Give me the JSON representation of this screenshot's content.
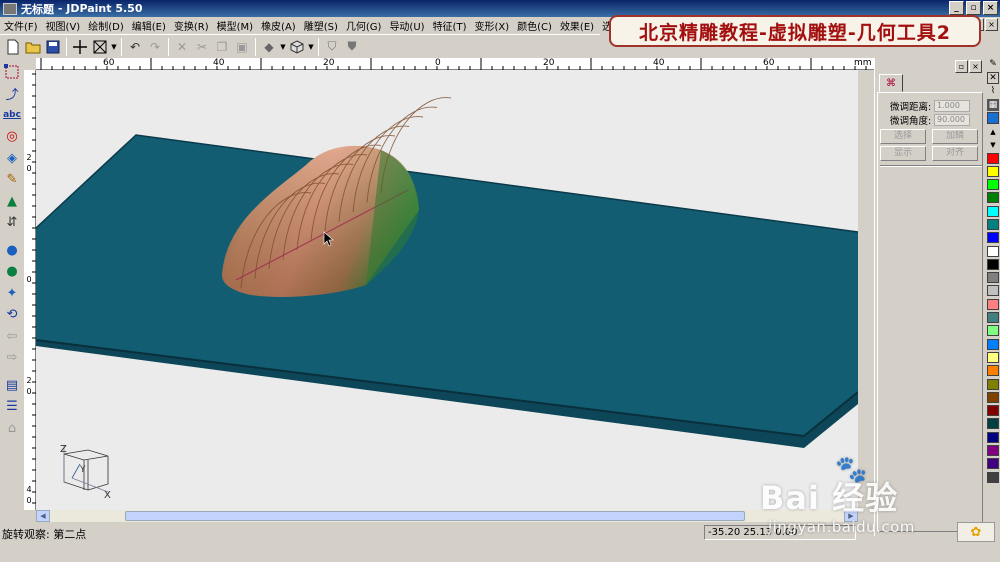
{
  "window": {
    "doc_title": "无标题",
    "app_title": "JDPaint 5.50"
  },
  "menu": [
    "文件(F)",
    "视图(V)",
    "绘制(D)",
    "编辑(E)",
    "变换(R)",
    "模型(M)",
    "橡皮(A)",
    "雕塑(S)",
    "几何(G)",
    "导动(U)",
    "特征(T)",
    "变形(X)",
    "颜色(C)",
    "效果(E)",
    "选项(O)",
    "艺"
  ],
  "banner": {
    "text": "北京精雕教程-虚拟雕塑-几何工具2"
  },
  "ruler": {
    "unit": "mm",
    "top_labels": [
      "60",
      "40",
      "20",
      "0",
      "20",
      "40",
      "60"
    ],
    "left_labels": [
      "2",
      "0",
      "0",
      "2",
      "0",
      "4",
      "0"
    ]
  },
  "panel": {
    "tab_icon": "select-tool-icon",
    "fine_distance_label": "微调距离:",
    "fine_distance_value": "1.000",
    "fine_angle_label": "微调角度:",
    "fine_angle_value": "90.000",
    "btn_select": "选择",
    "btn_add": "加鳞",
    "btn_show": "显示",
    "btn_align": "对齐"
  },
  "axes": {
    "z": "Z",
    "y": "Y",
    "x": "X"
  },
  "status": {
    "text": "旋转观察: 第二点",
    "coords": "-35.20 25.13 0.00"
  },
  "watermark": {
    "brand": "Bai  经验",
    "url": "jingyan.baidu.com"
  },
  "palette_colors": [
    "#ff0000",
    "#ffff00",
    "#00ff00",
    "#008000",
    "#00ffff",
    "#008080",
    "#0000ff",
    "#ffffff",
    "#000000",
    "#808080",
    "#c0c0c0",
    "#ff8080",
    "#408080",
    "#80ff80",
    "#0080ff",
    "#ffff80",
    "#ff8000",
    "#808000",
    "#804000",
    "#800000",
    "#004040",
    "#000080",
    "#800080",
    "#400080",
    "#404040"
  ],
  "colors": {
    "plate_top": "#125d72",
    "plate_side": "#0d4658",
    "viewport_bg": "#ebebeb",
    "banner_text": "#a30f0f"
  }
}
